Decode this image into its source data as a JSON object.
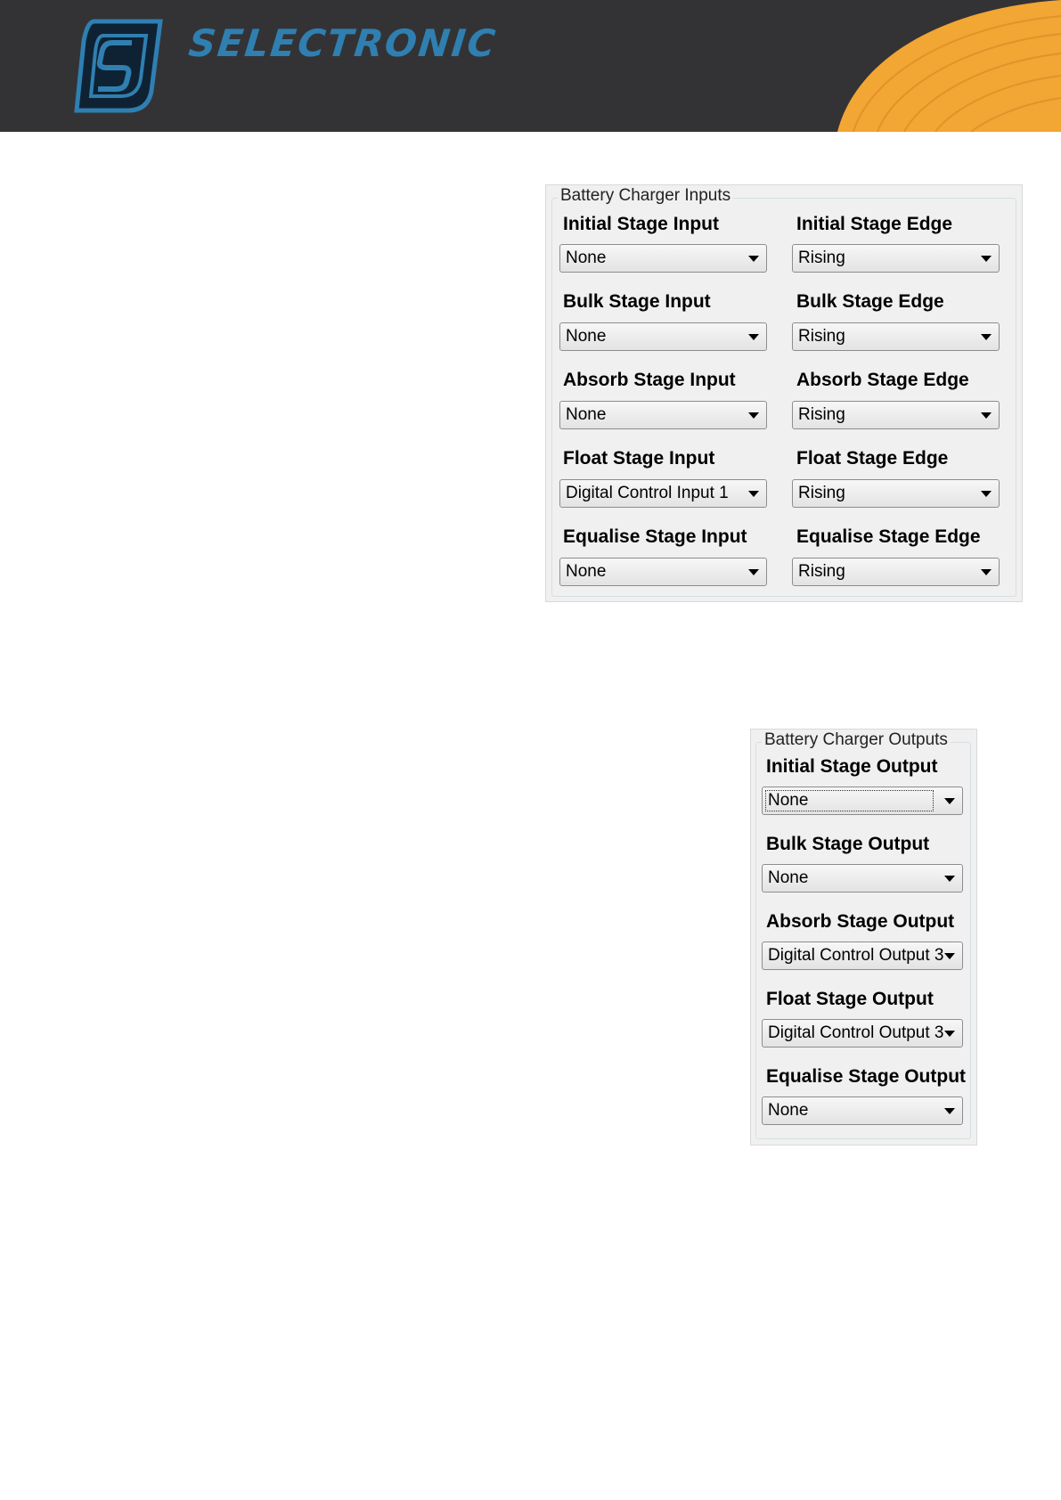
{
  "brand": {
    "name": "SELECTRONIC",
    "display_text": "SELECTRONIC"
  },
  "colors": {
    "banner": "#333335",
    "brand_blue": "#2f7fb1",
    "accent_orange": "#f2a633"
  },
  "inputs_panel": {
    "title": "Battery Charger Inputs",
    "rows": [
      {
        "input_label": "Initial Stage Input",
        "input_value": "None",
        "edge_label": "Initial Stage Edge",
        "edge_value": "Rising"
      },
      {
        "input_label": "Bulk Stage Input",
        "input_value": "None",
        "edge_label": "Bulk Stage Edge",
        "edge_value": "Rising"
      },
      {
        "input_label": "Absorb Stage Input",
        "input_value": "None",
        "edge_label": "Absorb Stage Edge",
        "edge_value": "Rising"
      },
      {
        "input_label": "Float Stage Input",
        "input_value": "Digital Control Input 1",
        "edge_label": "Float Stage Edge",
        "edge_value": "Rising"
      },
      {
        "input_label": "Equalise Stage Input",
        "input_value": "None",
        "edge_label": "Equalise Stage Edge",
        "edge_value": "Rising"
      }
    ]
  },
  "outputs_panel": {
    "title": "Battery Charger Outputs",
    "rows": [
      {
        "label": "Initial Stage Output",
        "value": "None",
        "focused": true
      },
      {
        "label": "Bulk Stage Output",
        "value": "None"
      },
      {
        "label": "Absorb Stage Output",
        "value": "Digital Control Output 3"
      },
      {
        "label": "Float Stage Output",
        "value": "Digital Control Output 3"
      },
      {
        "label": "Equalise Stage Output",
        "value": "None"
      }
    ]
  }
}
